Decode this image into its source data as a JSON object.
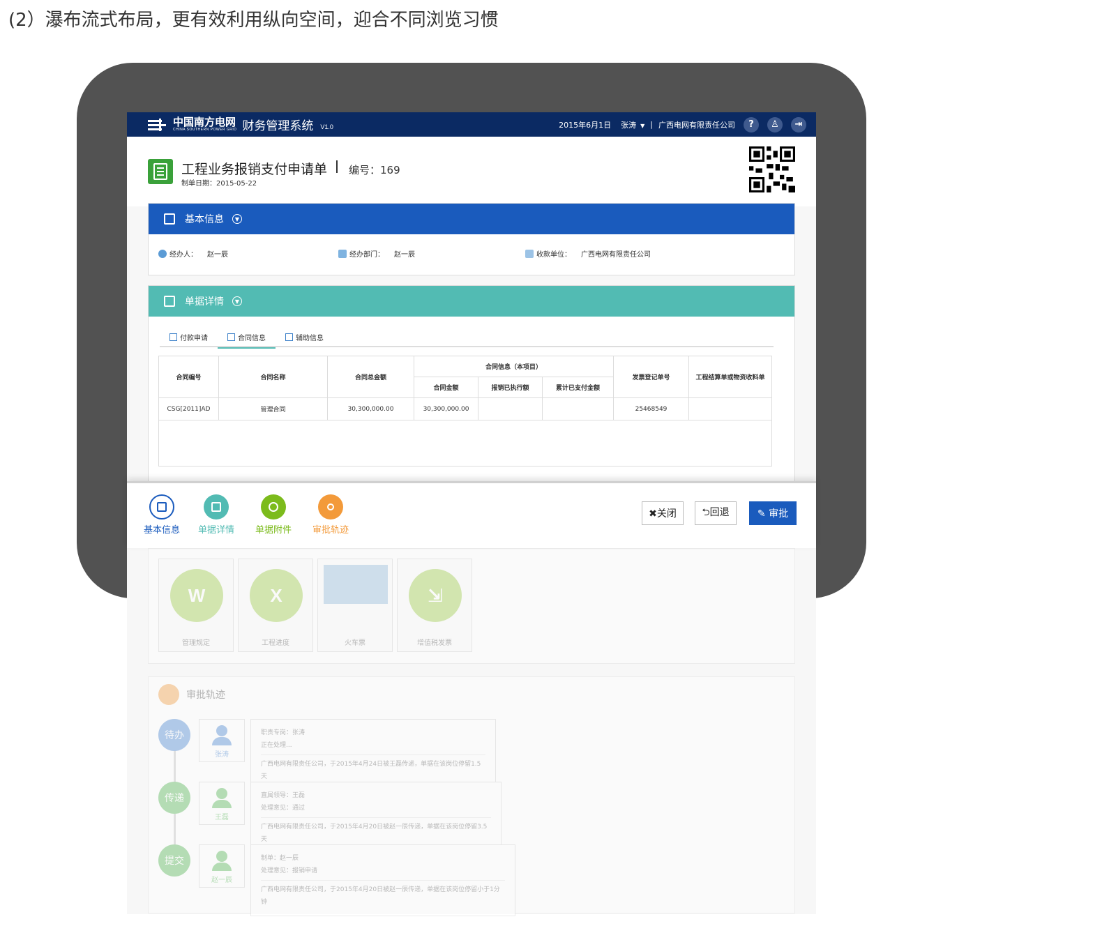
{
  "heading": "(2）瀑布流式布局，更有效利用纵向空间，迎合不同浏览习惯",
  "colors": {
    "topbar": "#0b2a63",
    "basic_header": "#1a5bbd",
    "detail_header": "#52bbb3",
    "approve_button": "#1a5bbd",
    "green": "#3aa13a",
    "orange": "#f39a3a"
  },
  "topbar": {
    "brand_cn": "中国南方电网",
    "brand_en": "CHINA SOUTHERN POWER GRID",
    "system_name": "财务管理系统",
    "version": "V1.0",
    "date": "2015年6月1日",
    "user": "张涛",
    "separator": "|",
    "company": "广西电网有限责任公司",
    "icons": [
      "help-icon",
      "user-icon",
      "logout-icon"
    ],
    "help_glyph": "?",
    "user_glyph": "♙",
    "logout_glyph": "⇥"
  },
  "form": {
    "title": "工程业务报销支付申请单",
    "divider": "|",
    "number": "编号：169",
    "date": "制单日期：2015-05-22"
  },
  "basic": {
    "title": "基本信息",
    "handler_label": "经办人：",
    "handler": "赵一辰",
    "dept_label": "经办部门：",
    "dept": "赵一辰",
    "payee_label": "收款单位：",
    "payee": "广西电网有限责任公司"
  },
  "detail": {
    "title": "单据详情",
    "tabs": [
      "付款申请",
      "合同信息",
      "辅助信息"
    ],
    "active_tab": 1,
    "table": {
      "headers": [
        "合同编号",
        "合同名称",
        "合同总金额",
        "合同信息（本项目）",
        "发票登记单号",
        "工程结算单或物资收料单"
      ],
      "subheaders": [
        "合同金额",
        "报销已执行额",
        "累计已支付金额"
      ],
      "rows": [
        [
          "CSG[2011]AD",
          "管理合同",
          "30,300,000.00",
          "30,300,000.00",
          "",
          "",
          "25468549",
          ""
        ]
      ]
    }
  },
  "footer": {
    "nav": [
      {
        "label": "基本信息",
        "color": "#1a5bbd"
      },
      {
        "label": "单据详情",
        "color": "#52bbb3"
      },
      {
        "label": "单据附件",
        "color": "#7cbb1c"
      },
      {
        "label": "审批轨迹",
        "color": "#f39a3a"
      }
    ],
    "buttons": {
      "close": "✖关闭",
      "back": "⮌回退",
      "approve": "✎ 审批"
    }
  },
  "attachments": [
    {
      "caption": "管理规定",
      "glyph": "W"
    },
    {
      "caption": "工程进度",
      "glyph": "X"
    },
    {
      "caption": "火车票",
      "glyph": ""
    },
    {
      "caption": "增值税发票",
      "glyph": "⇲"
    }
  ],
  "trace": {
    "title": "审批轨迹",
    "steps": [
      {
        "node": "待办",
        "name": "张涛",
        "line1": "职责专岗：张涛",
        "line2": "正在处理...",
        "line3": "广西电网有限责任公司，于2015年4月24日被王磊传递，单据在该岗位停留1.5天"
      },
      {
        "node": "传递",
        "name": "王磊",
        "line1": "直属领导：王磊",
        "line2": "处理意见：通过",
        "line3": "广西电网有限责任公司，于2015年4月20日被赵一辰传递，单据在该岗位停留3.5天"
      },
      {
        "node": "提交",
        "name": "赵一辰",
        "line1": "制单：赵一辰",
        "line2": "处理意见：报销申请",
        "line3": "广西电网有限责任公司，于2015年4月20日被赵一辰传递，单据在该岗位停留小于1分钟"
      }
    ]
  }
}
